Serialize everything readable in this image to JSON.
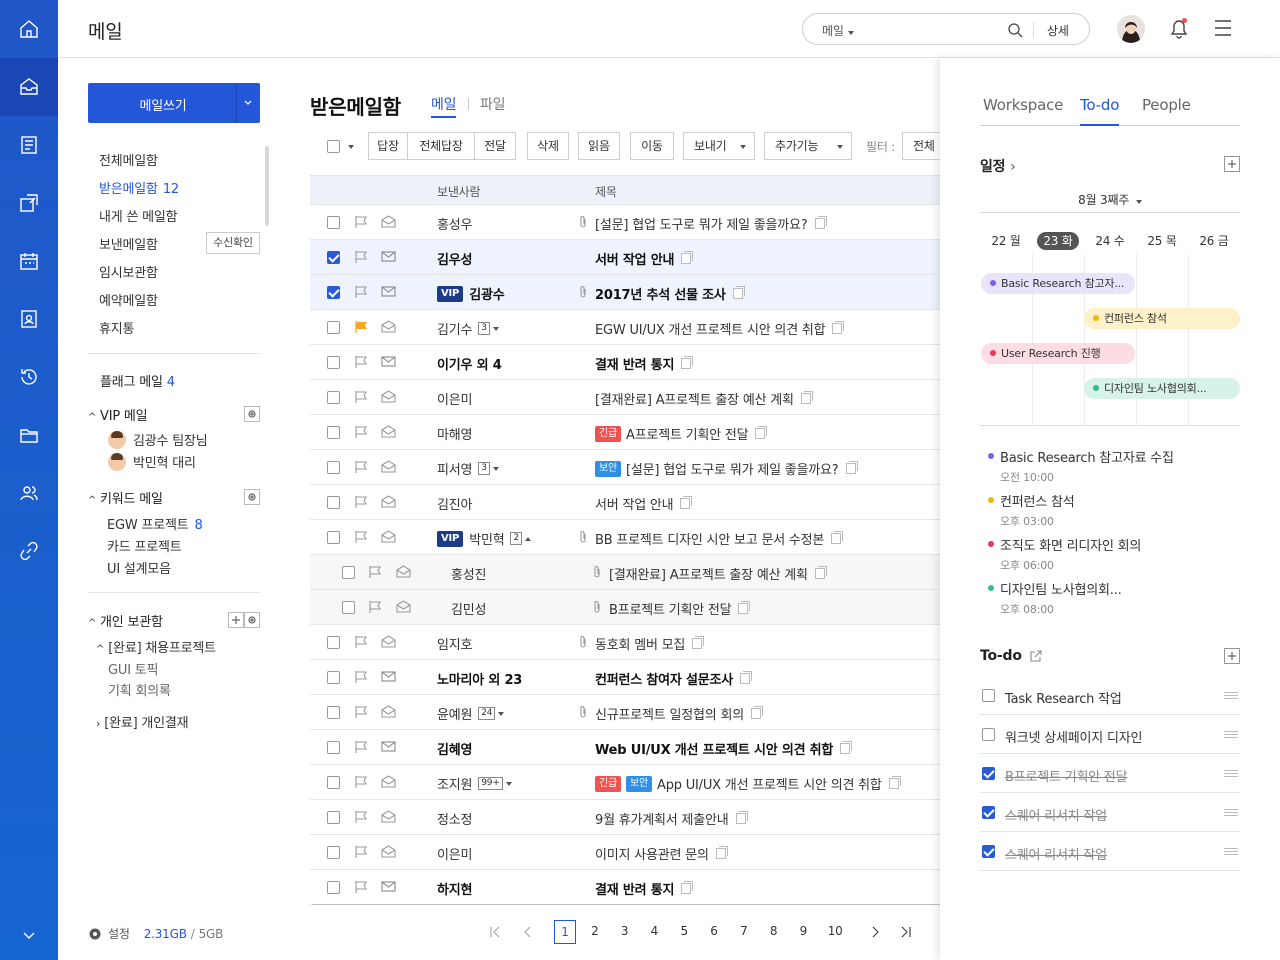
{
  "app": {
    "title": "메일"
  },
  "search": {
    "scope": "메일",
    "placeholder": "",
    "detail": "상세"
  },
  "rail": {
    "items": [
      "home-icon",
      "mail-icon",
      "board-icon",
      "approval-icon",
      "calendar-icon",
      "contacts-icon",
      "history-icon",
      "folder-icon",
      "people-icon",
      "link-icon"
    ]
  },
  "sidebar": {
    "compose": "메일쓰기",
    "folders": [
      {
        "label": "전체메일함"
      },
      {
        "label": "받은메일함",
        "count": "12"
      },
      {
        "label": "내게 쓴 메일함"
      },
      {
        "label": "보낸메일함"
      },
      {
        "label": "임시보관함"
      },
      {
        "label": "예약메일함"
      },
      {
        "label": "휴지통"
      }
    ],
    "receipt_check": "수신확인",
    "flag_mail": {
      "label": "플래그 메일",
      "count": "4"
    },
    "vip": {
      "label": "VIP 메일",
      "people": [
        "김광수 팀장님",
        "박민혁 대리"
      ]
    },
    "keyword": {
      "label": "키워드 메일",
      "items": [
        {
          "label": "EGW 프로젝트",
          "count": "8"
        },
        {
          "label": "카드 프로젝트"
        },
        {
          "label": "UI 설계모음"
        }
      ]
    },
    "personal": {
      "label": "개인 보관함",
      "group1": "[완료] 채용프로젝트",
      "sub1": "GUI 토픽",
      "sub2": "기획 회의록",
      "group2": "[완료] 개인결재"
    },
    "footer": {
      "settings": "설정",
      "used": "2.31GB",
      "sep": "/",
      "total": "5GB"
    }
  },
  "main": {
    "title": "받은메일함",
    "tabs": [
      "메일",
      "파일"
    ],
    "toolbar": {
      "reply": "답장",
      "reply_all": "전체답장",
      "forward": "전달",
      "delete": "삭제",
      "read": "읽음",
      "move": "이동",
      "send": "보내기",
      "more": "추가기능",
      "filter_label": "필터 :",
      "filter_value": "전체"
    },
    "columns": {
      "sender": "보낸사람",
      "subject": "제목"
    },
    "rows": [
      {
        "sender": "홍성우",
        "subject": "[설문] 협업 도구로 뭐가 제일 좋을까요?",
        "attach": true
      },
      {
        "sender": "김우성",
        "subject": "서버 작업 안내",
        "selected": true,
        "unread": true
      },
      {
        "sender": "김광수",
        "subject": "2017년 추석 선물 조사",
        "selected": true,
        "unread": true,
        "vip": "VIP",
        "attach": true
      },
      {
        "sender": "김기수",
        "subject": "EGW UI/UX 개선 프로젝트 시안 의견 취합",
        "flag": true,
        "count": "3"
      },
      {
        "sender": "이기우 외 4",
        "subject": "결재 반려 통지",
        "unread": true
      },
      {
        "sender": "이은미",
        "subject": "[결재완료] A프로젝트 출장 예산 계획"
      },
      {
        "sender": "마해영",
        "subject": "A프로젝트 기획안 전달",
        "tag": "긴급",
        "tag_color": "red"
      },
      {
        "sender": "피서영",
        "subject": "[설문] 협업 도구로 뭐가 제일 좋을까요?",
        "count": "3",
        "tag": "보안",
        "tag_color": "blue"
      },
      {
        "sender": "김진아",
        "subject": "서버 작업 안내"
      },
      {
        "sender": "박민혁",
        "subject": "BB 프로젝트 디자인 시안 보고 문서 수정본",
        "vip": "VIP",
        "count": "2",
        "attach": true,
        "expanded": true
      },
      {
        "sender": "홍성진",
        "subject": "[결재완료] A프로젝트 출장 예산 계획",
        "child": true,
        "attach": true
      },
      {
        "sender": "김민성",
        "subject": "B프로젝트 기획안 전달",
        "child": true,
        "attach": true
      },
      {
        "sender": "임지호",
        "subject": "동호회 멤버 모집",
        "attach": true
      },
      {
        "sender": "노마리아 외 23",
        "subject": "컨퍼런스 참여자 설문조사",
        "unread": true
      },
      {
        "sender": "윤예원",
        "subject": "신규프로젝트 일정협의 회의",
        "count": "24",
        "attach": true
      },
      {
        "sender": "김혜영",
        "subject": "Web UI/UX 개선 프로젝트 시안 의견 취합",
        "unread": true
      },
      {
        "sender": "조지원",
        "subject": "App UI/UX 개선 프로젝트 시안 의견 취합",
        "count": "99+",
        "tag": "긴급",
        "tag_color": "red",
        "tag2": "보안"
      },
      {
        "sender": "정소정",
        "subject": "9월 휴가계획서 제출안내"
      },
      {
        "sender": "이은미",
        "subject": "이미지 사용관련 문의"
      },
      {
        "sender": "하지현",
        "subject": "결재 반려 통지",
        "unread": true
      }
    ],
    "pager": {
      "pages": [
        "1",
        "2",
        "3",
        "4",
        "5",
        "6",
        "7",
        "8",
        "9",
        "10"
      ],
      "current": "1"
    }
  },
  "right": {
    "tabs": [
      "Workspace",
      "To-do",
      "People"
    ],
    "active_tab": "To-do",
    "schedule_title": "일정",
    "week_label": "8월 3째주",
    "days": [
      "22 월",
      "23 화",
      "24 수",
      "25 목",
      "26 금"
    ],
    "today": "23 화",
    "events": [
      {
        "label": "Basic Research 참고자...",
        "color": "#7b61e8",
        "bg": "#e9e4fb"
      },
      {
        "label": "컨퍼런스 참석",
        "color": "#f2b705",
        "bg": "#fdf1c9"
      },
      {
        "label": "User Research 진행",
        "color": "#e5395b",
        "bg": "#fbdde3"
      },
      {
        "label": "디자인팀 노사협의회...",
        "color": "#2cbf8f",
        "bg": "#d7f3e9"
      }
    ],
    "schedule": [
      {
        "title": "Basic Research 참고자료 수집",
        "time": "오전 10:00",
        "color": "#7b61e8"
      },
      {
        "title": "컨퍼런스 참석",
        "time": "오후 03:00",
        "color": "#f2b705"
      },
      {
        "title": "조직도 화면 리디자인 회의",
        "time": "오후 06:00",
        "color": "#e5395b"
      },
      {
        "title": "디자인팀 노사협의회...",
        "time": "오후 08:00",
        "color": "#2cbf8f"
      }
    ],
    "todo_title": "To-do",
    "todos": [
      {
        "label": "Task Research 작업",
        "done": false
      },
      {
        "label": "워크넷 상세페이지 디자인",
        "done": false
      },
      {
        "label": "B프로젝트 기획안 전달",
        "done": true
      },
      {
        "label": "스퀘어 리서치 작업",
        "done": true
      },
      {
        "label": "스퀘어 리서치 작업",
        "done": true
      }
    ]
  },
  "colors": {
    "accent": "#2356d9",
    "rail": "#1d5fd0",
    "urgent": "#ef5350",
    "secure": "#2f8fe6",
    "vip": "#1e3b88"
  }
}
